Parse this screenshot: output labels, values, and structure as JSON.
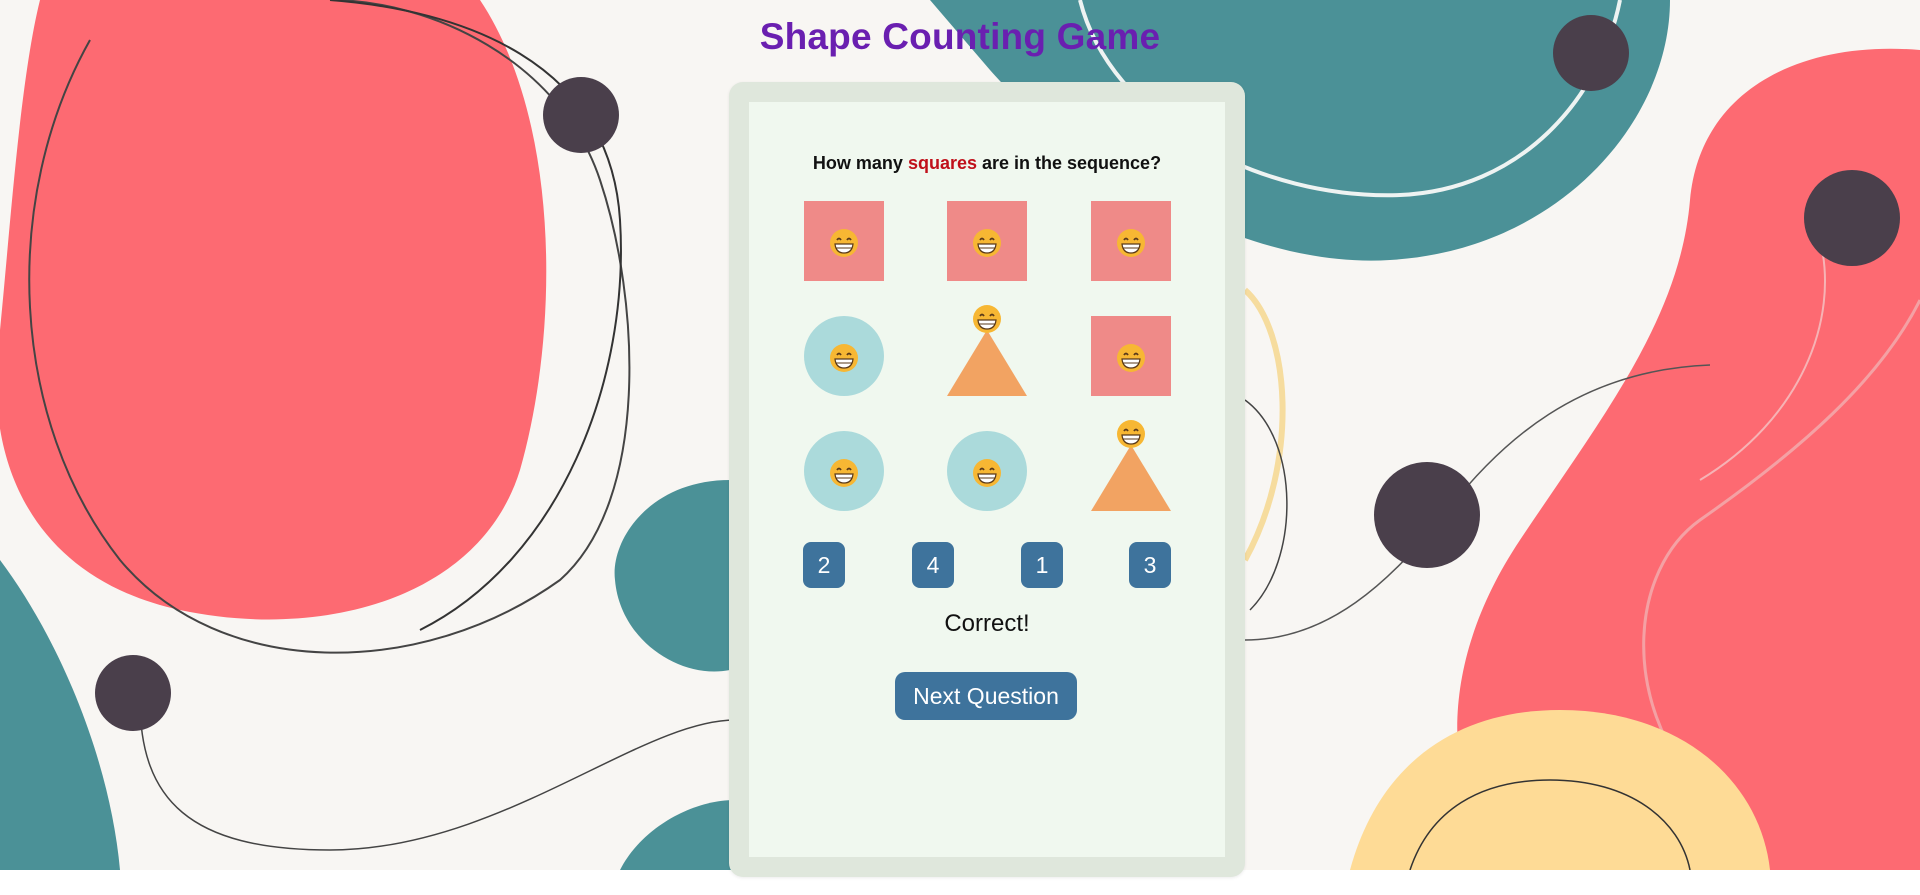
{
  "title": "Shape Counting Game",
  "question": {
    "prefix": "How many ",
    "target": "squares",
    "suffix": " are in the sequence?"
  },
  "grid": [
    {
      "shape": "square",
      "icon": "grinning-face-icon"
    },
    {
      "shape": "square",
      "icon": "grinning-face-icon"
    },
    {
      "shape": "square",
      "icon": "grinning-face-icon"
    },
    {
      "shape": "circle",
      "icon": "grinning-face-icon"
    },
    {
      "shape": "triangle",
      "icon": "grinning-face-icon"
    },
    {
      "shape": "square",
      "icon": "grinning-face-icon"
    },
    {
      "shape": "circle",
      "icon": "grinning-face-icon"
    },
    {
      "shape": "circle",
      "icon": "grinning-face-icon"
    },
    {
      "shape": "triangle",
      "icon": "grinning-face-icon"
    }
  ],
  "answers": [
    "2",
    "4",
    "1",
    "3"
  ],
  "feedback": "Correct!",
  "next_button": "Next Question",
  "colors": {
    "title": "#6a1fb0",
    "highlight": "#c0101a",
    "square": "#ef8a88",
    "circle": "#abdadb",
    "triangle": "#f2a362",
    "button": "#3e739c",
    "card_outer": "#dfe7dc",
    "card_inner": "#f0f8ef"
  }
}
